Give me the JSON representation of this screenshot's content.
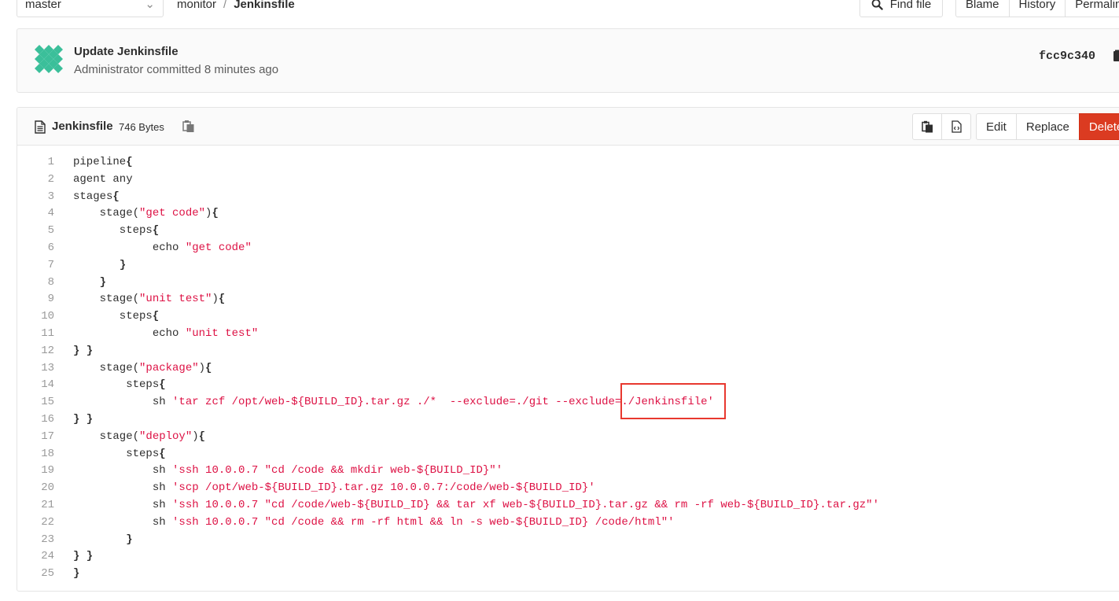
{
  "topbar": {
    "branch": "master",
    "breadcrumb": {
      "project": "monitor",
      "separator": "/",
      "file": "Jenkinsfile"
    },
    "find_file_label": "Find file",
    "buttons": [
      "Blame",
      "History",
      "Permalink"
    ]
  },
  "commit": {
    "title": "Update Jenkinsfile",
    "meta": "Administrator committed 8 minutes ago",
    "sha": "fcc9c340"
  },
  "file": {
    "name": "Jenkinsfile",
    "size": "746 Bytes",
    "actions": {
      "edit": "Edit",
      "replace": "Replace",
      "delete": "Delete"
    }
  },
  "colors": {
    "delete": "#db3b21",
    "string": "#dd1144",
    "highlight": "#e8382f",
    "avatar": "#3bbf9a"
  },
  "code_lines": [
    [
      {
        "t": "pipeline"
      },
      {
        "t": "{",
        "b": true
      }
    ],
    [
      {
        "t": "agent any"
      }
    ],
    [
      {
        "t": "stages"
      },
      {
        "t": "{",
        "b": true
      }
    ],
    [
      {
        "t": "    stage("
      },
      {
        "t": "\"get code\"",
        "s": true
      },
      {
        "t": ")"
      },
      {
        "t": "{",
        "b": true
      }
    ],
    [
      {
        "t": "       steps"
      },
      {
        "t": "{",
        "b": true
      }
    ],
    [
      {
        "t": "            echo "
      },
      {
        "t": "\"get code\"",
        "s": true
      }
    ],
    [
      {
        "t": "       "
      },
      {
        "t": "}",
        "b": true
      }
    ],
    [
      {
        "t": "    "
      },
      {
        "t": "}",
        "b": true
      }
    ],
    [
      {
        "t": "    stage("
      },
      {
        "t": "\"unit test\"",
        "s": true
      },
      {
        "t": ")"
      },
      {
        "t": "{",
        "b": true
      }
    ],
    [
      {
        "t": "       steps"
      },
      {
        "t": "{",
        "b": true
      }
    ],
    [
      {
        "t": "            echo "
      },
      {
        "t": "\"unit test\"",
        "s": true
      }
    ],
    [
      {
        "t": "} }",
        "b": true
      }
    ],
    [
      {
        "t": "    stage("
      },
      {
        "t": "\"package\"",
        "s": true
      },
      {
        "t": ")"
      },
      {
        "t": "{",
        "b": true
      }
    ],
    [
      {
        "t": "        steps"
      },
      {
        "t": "{",
        "b": true
      }
    ],
    [
      {
        "t": "            sh "
      },
      {
        "t": "'tar zcf /opt/web-${BUILD_ID}.tar.gz ./*  --exclude=./git --exclude=./Jenkinsfile'",
        "s": true
      }
    ],
    [
      {
        "t": "} }",
        "b": true
      }
    ],
    [
      {
        "t": "    stage("
      },
      {
        "t": "\"deploy\"",
        "s": true
      },
      {
        "t": ")"
      },
      {
        "t": "{",
        "b": true
      }
    ],
    [
      {
        "t": "        steps"
      },
      {
        "t": "{",
        "b": true
      }
    ],
    [
      {
        "t": "            sh "
      },
      {
        "t": "'ssh 10.0.0.7 \"cd /code && mkdir web-${BUILD_ID}\"'",
        "s": true
      }
    ],
    [
      {
        "t": "            sh "
      },
      {
        "t": "'scp /opt/web-${BUILD_ID}.tar.gz 10.0.0.7:/code/web-${BUILD_ID}'",
        "s": true
      }
    ],
    [
      {
        "t": "            sh "
      },
      {
        "t": "'ssh 10.0.0.7 \"cd /code/web-${BUILD_ID} && tar xf web-${BUILD_ID}.tar.gz && rm -rf web-${BUILD_ID}.tar.gz\"'",
        "s": true
      }
    ],
    [
      {
        "t": "            sh "
      },
      {
        "t": "'ssh 10.0.0.7 \"cd /code && rm -rf html && ln -s web-${BUILD_ID} /code/html\"'",
        "s": true
      }
    ],
    [
      {
        "t": "        "
      },
      {
        "t": "}",
        "b": true
      }
    ],
    [
      {
        "t": "} }",
        "b": true
      }
    ],
    [
      {
        "t": "}",
        "b": true
      }
    ]
  ]
}
